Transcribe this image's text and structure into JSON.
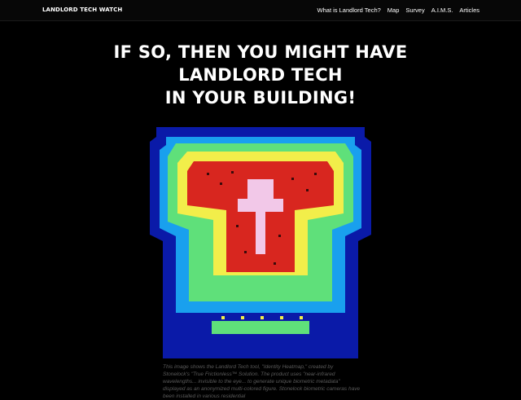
{
  "nav": {
    "brand": "LANDLORD TECH WATCH",
    "links": [
      {
        "label": "What is Landlord Tech?"
      },
      {
        "label": "Map"
      },
      {
        "label": "Survey"
      },
      {
        "label": "A.I.M.S."
      },
      {
        "label": "Articles"
      }
    ]
  },
  "hero": {
    "lines": [
      "IF SO, THEN YOU MIGHT HAVE",
      "LANDLORD TECH",
      "IN YOUR BUILDING!"
    ]
  },
  "figure": {
    "caption": "This image shows the Landlord Tech tool, \"Identity Heatmap,\" created by Stonelock's \"True Frictionless™ Solution. The product uses \"near-infrared wavelengths... invisible to the eye... to generate unique biometric metadata\" displayed as an anonymized multi-colored figure. Stonelock biometric cameras have been installed in various residential",
    "colors": {
      "cold": "#0a1aa8",
      "cool": "#19a0ee",
      "mild": "#5fe07a",
      "warm": "#f2ee4a",
      "hot": "#d8261f",
      "core": "#f2c8e8"
    }
  }
}
